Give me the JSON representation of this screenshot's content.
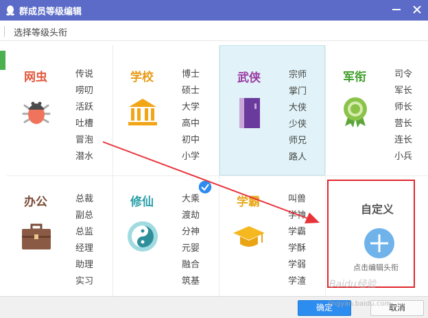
{
  "window": {
    "title": "群成员等级编辑",
    "icon": "qq-penguin-icon"
  },
  "subheader": {
    "title": "选择等级头衔"
  },
  "colors": {
    "titlebar": "#5b6bc7",
    "accent": "#2d8cf0",
    "highlight_box": "#e0262d",
    "selected_bg": "#e1f3f8"
  },
  "categories": [
    {
      "name": "网虫",
      "color": "#e2573b",
      "icon": "bug-icon",
      "titles": [
        "传说",
        "唠叨",
        "活跃",
        "吐槽",
        "冒泡",
        "潜水"
      ]
    },
    {
      "name": "学校",
      "color": "#e89b16",
      "icon": "school-building-icon",
      "titles": [
        "博士",
        "硕士",
        "大学",
        "高中",
        "初中",
        "小学"
      ]
    },
    {
      "name": "武侠",
      "color": "#9b3aa3",
      "icon": "book-icon",
      "titles": [
        "宗师",
        "掌门",
        "大侠",
        "少侠",
        "师兄",
        "路人"
      ]
    },
    {
      "name": "军衔",
      "color": "#3f9d2a",
      "icon": "medal-icon",
      "titles": [
        "司令",
        "军长",
        "师长",
        "营长",
        "连长",
        "小兵"
      ]
    },
    {
      "name": "办公",
      "color": "#7a4a36",
      "icon": "briefcase-icon",
      "titles": [
        "总裁",
        "副总",
        "总监",
        "经理",
        "助理",
        "实习"
      ]
    },
    {
      "name": "修仙",
      "color": "#2ba0a8",
      "icon": "yin-yang-icon",
      "titles": [
        "大乘",
        "渡劫",
        "分神",
        "元婴",
        "融合",
        "筑基"
      ]
    },
    {
      "name": "学霸",
      "color": "#e8a81a",
      "icon": "graduation-cap-icon",
      "titles": [
        "叫兽",
        "学神",
        "学霸",
        "学酥",
        "学弱",
        "学渣"
      ]
    }
  ],
  "custom": {
    "title": "自定义",
    "hint": "点击编辑头衔",
    "icon": "plus-circle-icon"
  },
  "buttons": {
    "ok": "确定",
    "cancel": "取消"
  },
  "watermark": {
    "text": "Baidu经验",
    "url_text": "jingyan.baidu.com"
  }
}
